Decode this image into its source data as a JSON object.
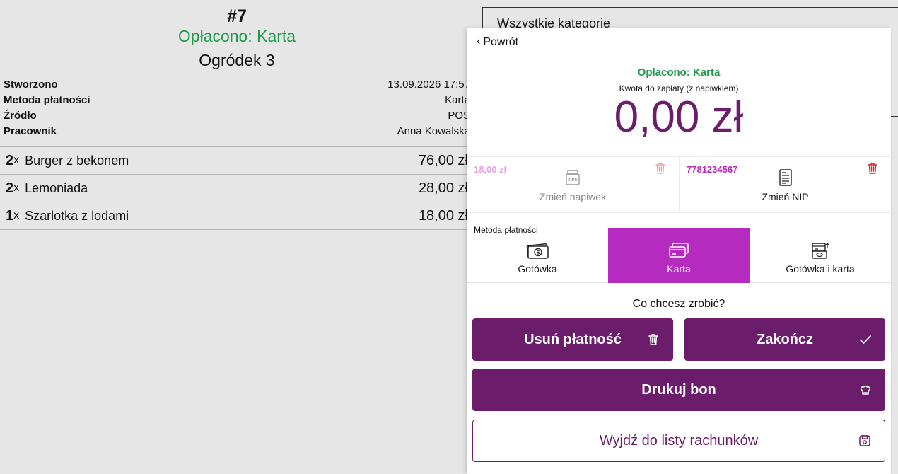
{
  "order": {
    "number": "#7",
    "status": "Opłacono: Karta",
    "table": "Ogródek 3",
    "info": [
      {
        "label": "Stworzono",
        "value": "13.09.2026 17:57"
      },
      {
        "label": "Metoda płatności",
        "value": "Karta"
      },
      {
        "label": "Źródło",
        "value": "POS"
      },
      {
        "label": "Pracownik",
        "value": "Anna Kowalska"
      }
    ],
    "items": [
      {
        "qty": "2",
        "x": "x",
        "name": "Burger z bekonem",
        "price": "76,00 zł"
      },
      {
        "qty": "2",
        "x": "x",
        "name": "Lemoniada",
        "price": "28,00 zł"
      },
      {
        "qty": "1",
        "x": "x",
        "name": "Szarlotka z lodami",
        "price": "18,00 zł"
      }
    ]
  },
  "categories": {
    "label": "Wszystkie kategorie"
  },
  "panel": {
    "back_label": "Powrót",
    "status": "Opłacono: Karta",
    "amount_hint": "Kwota do zapłaty (z napiwkiem)",
    "amount": "0,00 zł",
    "tip": {
      "value": "18,00 zł",
      "label": "Zmień napiwek"
    },
    "nip": {
      "value": "7781234567",
      "label": "Zmień NIP"
    },
    "method_title": "Metoda płatności",
    "methods": [
      {
        "label": "Gotówka",
        "icon": "cash-icon",
        "active": false
      },
      {
        "label": "Karta",
        "icon": "card-icon",
        "active": true
      },
      {
        "label": "Gotówka i karta",
        "icon": "cash-and-card-icon",
        "active": false
      }
    ],
    "question": "Co chcesz zrobić?",
    "buttons": {
      "delete": "Usuń płatność",
      "finish": "Zakończ",
      "print": "Drukuj bon",
      "exit": "Wyjdź do listy rachunków"
    }
  },
  "colors": {
    "accent": "#6b1d6b",
    "active_method": "#b52bc0",
    "paid_green": "#1f9a4b",
    "delete_red": "#e02020"
  }
}
